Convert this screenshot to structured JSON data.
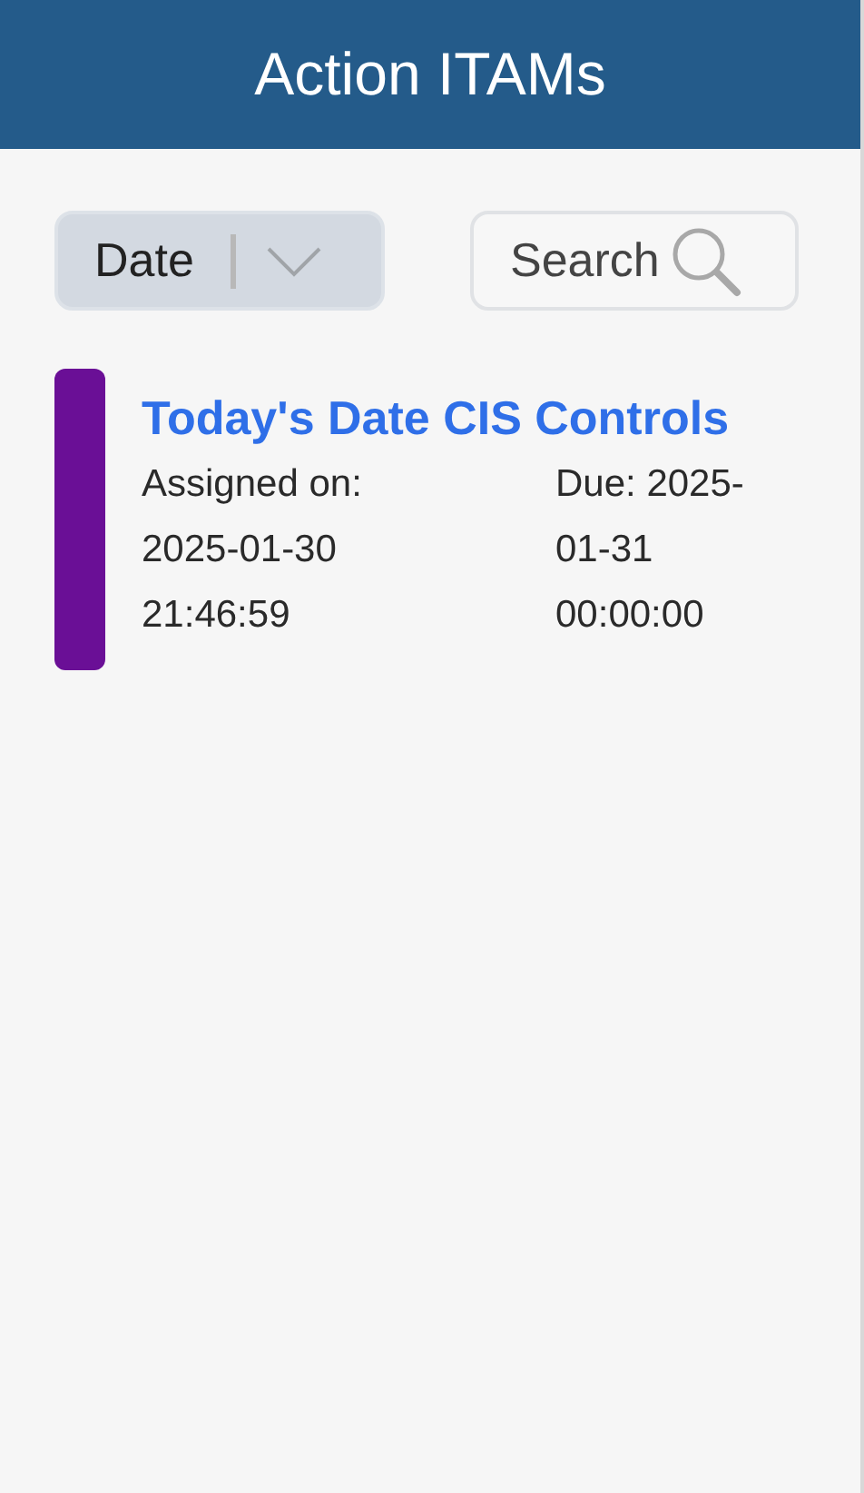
{
  "header": {
    "title": "Action ITAMs"
  },
  "sort_dropdown": {
    "value": "Date"
  },
  "search_button": {
    "label": "Search"
  },
  "items": [
    {
      "color": "#6a0f96",
      "title": "Today's Date CIS Controls",
      "assigned_lines": [
        "Assigned on:",
        "2025-01-30",
        "21:46:59"
      ],
      "due_lines": [
        "Due: 2025-",
        "01-31",
        "00:00:00"
      ]
    }
  ]
}
